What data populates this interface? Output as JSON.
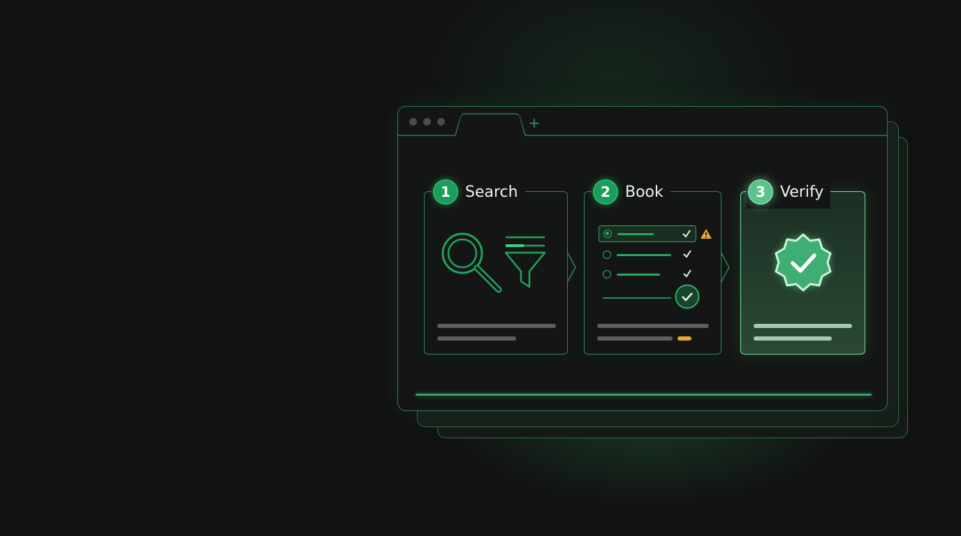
{
  "steps": [
    {
      "number": "1",
      "label": "Search"
    },
    {
      "number": "2",
      "label": "Book"
    },
    {
      "number": "3",
      "label": "Verify"
    }
  ],
  "window": {
    "new_tab_symbol": "+"
  },
  "colors": {
    "accent": "#2fae6a",
    "accent_glow": "#5cc28c",
    "warning": "#e8a634",
    "background": "#121212"
  },
  "icons": {
    "search_card": [
      "magnifier-icon",
      "filter-icon"
    ],
    "book_card": [
      "radio-icon",
      "check-icon",
      "warning-icon",
      "confirm-check-icon"
    ],
    "verify_card": [
      "verified-badge-icon"
    ]
  }
}
